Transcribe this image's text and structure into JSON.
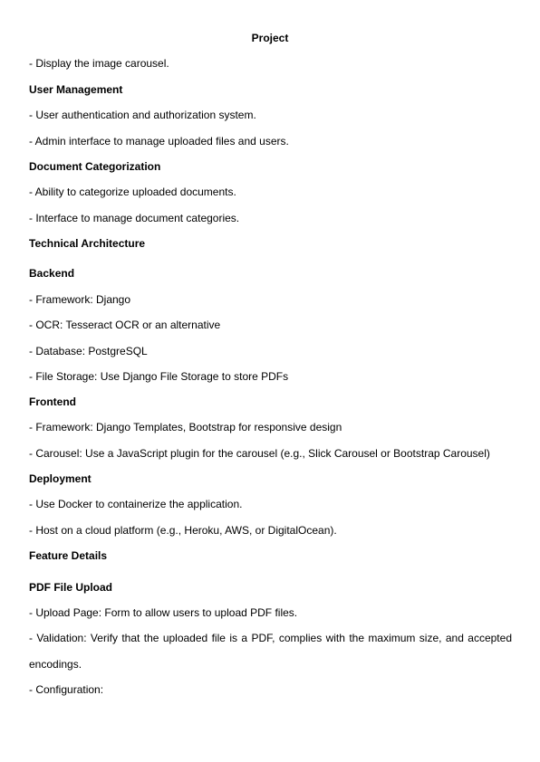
{
  "document": {
    "title": "Project",
    "lines": [
      "- Display the image carousel.",
      "User Management",
      "- User authentication and authorization system.",
      "- Admin interface to manage uploaded files and users.",
      "Document Categorization",
      "- Ability to categorize uploaded documents.",
      "- Interface to manage document categories.",
      "Technical Architecture",
      "Backend",
      "- Framework: Django",
      "- OCR: Tesseract OCR or an alternative",
      "- Database: PostgreSQL",
      "- File Storage: Use Django File Storage to store PDFs",
      "Frontend",
      "- Framework: Django Templates, Bootstrap for responsive design",
      "- Carousel: Use a JavaScript plugin for the carousel (e.g., Slick Carousel or Bootstrap Carousel)",
      "Deployment",
      "- Use Docker to containerize the application.",
      "- Host on a cloud platform (e.g., Heroku, AWS, or DigitalOcean).",
      "Feature Details",
      "PDF File Upload",
      "- Upload Page: Form to allow users to upload PDF files.",
      "- Validation: Verify that the uploaded file is a PDF, complies with the maximum size, and accepted",
      "encodings.",
      "- Configuration:"
    ]
  }
}
